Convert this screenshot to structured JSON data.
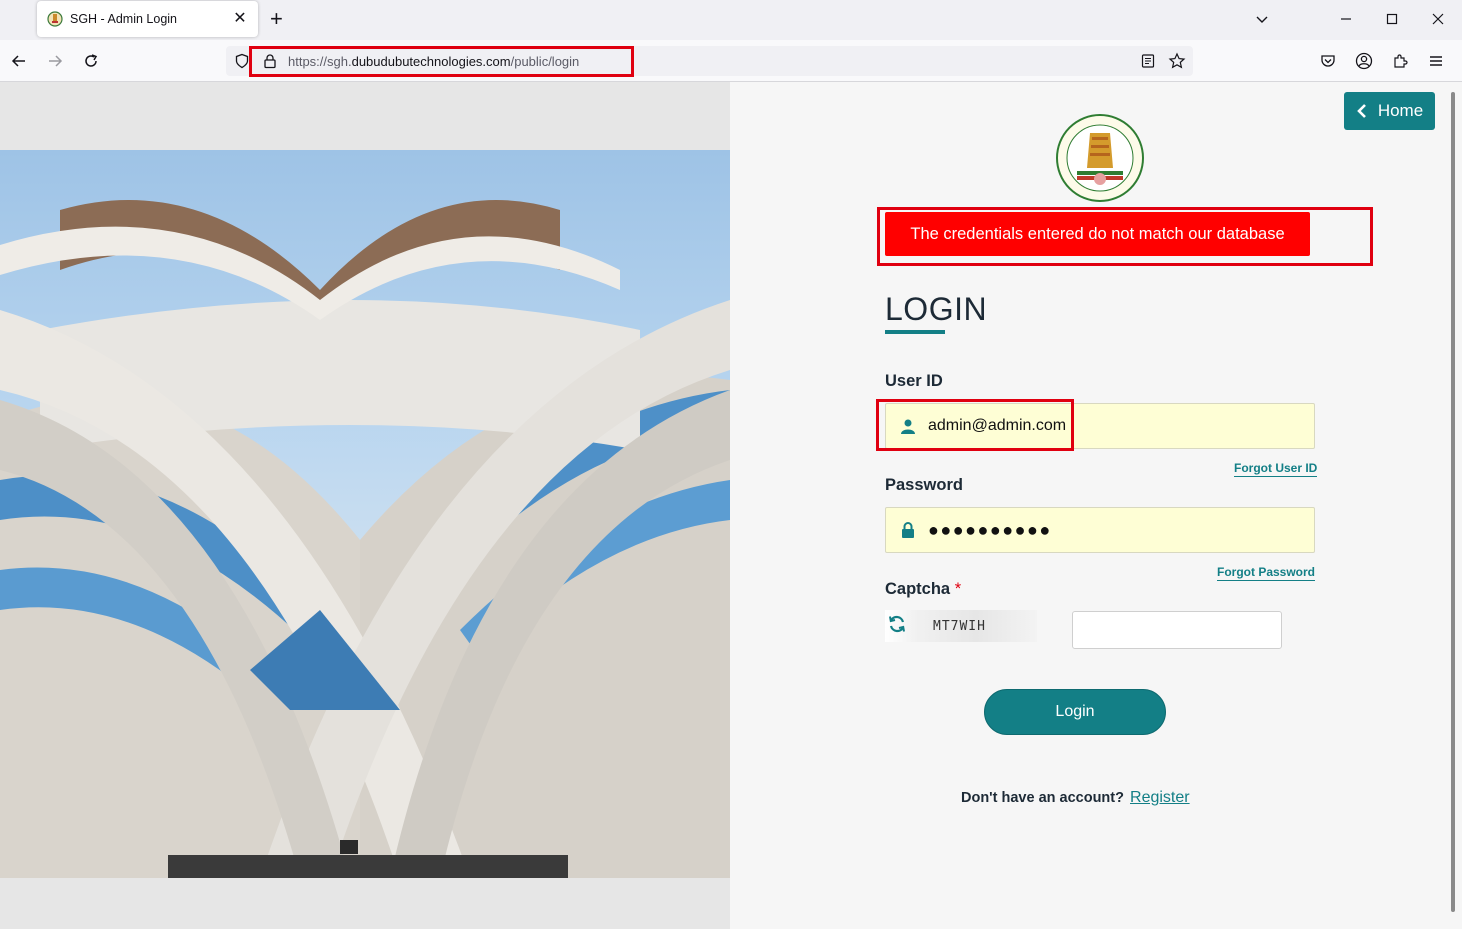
{
  "browser": {
    "tab_title": "SGH - Admin Login",
    "url_prefix": "https://sgh.",
    "url_domain": "dubudubutechnologies.com",
    "url_path": "/public/login"
  },
  "header": {
    "home_label": "Home"
  },
  "alert": {
    "message": "The credentials entered do not match our database",
    "color": "#ff0000"
  },
  "login": {
    "title": "LOGIN",
    "user_id_label": "User ID",
    "user_id_value": "admin@admin.com",
    "forgot_user_id": "Forgot User ID",
    "password_label": "Password",
    "password_value": "●●●●●●●●●●",
    "forgot_password": "Forgot Password",
    "captcha_label": "Captcha",
    "captcha_required": "*",
    "captcha_code": "MT7WIH",
    "captcha_input_value": "",
    "submit_label": "Login",
    "no_account_text": "Don't have an account?",
    "register_label": "Register"
  },
  "theme": {
    "accent": "#137f86",
    "input_bg": "#fefed5",
    "highlight_outline": "#e00010"
  },
  "icons": [
    "site-favicon",
    "tab-close-icon",
    "new-tab-icon",
    "back-icon",
    "forward-icon",
    "reload-icon",
    "shield-icon",
    "lock-icon",
    "reader-view-icon",
    "bookmark-star-icon",
    "pocket-icon",
    "account-icon",
    "extensions-icon",
    "menu-icon",
    "chevron-left-icon",
    "user-icon",
    "padlock-icon",
    "refresh-captcha-icon"
  ]
}
